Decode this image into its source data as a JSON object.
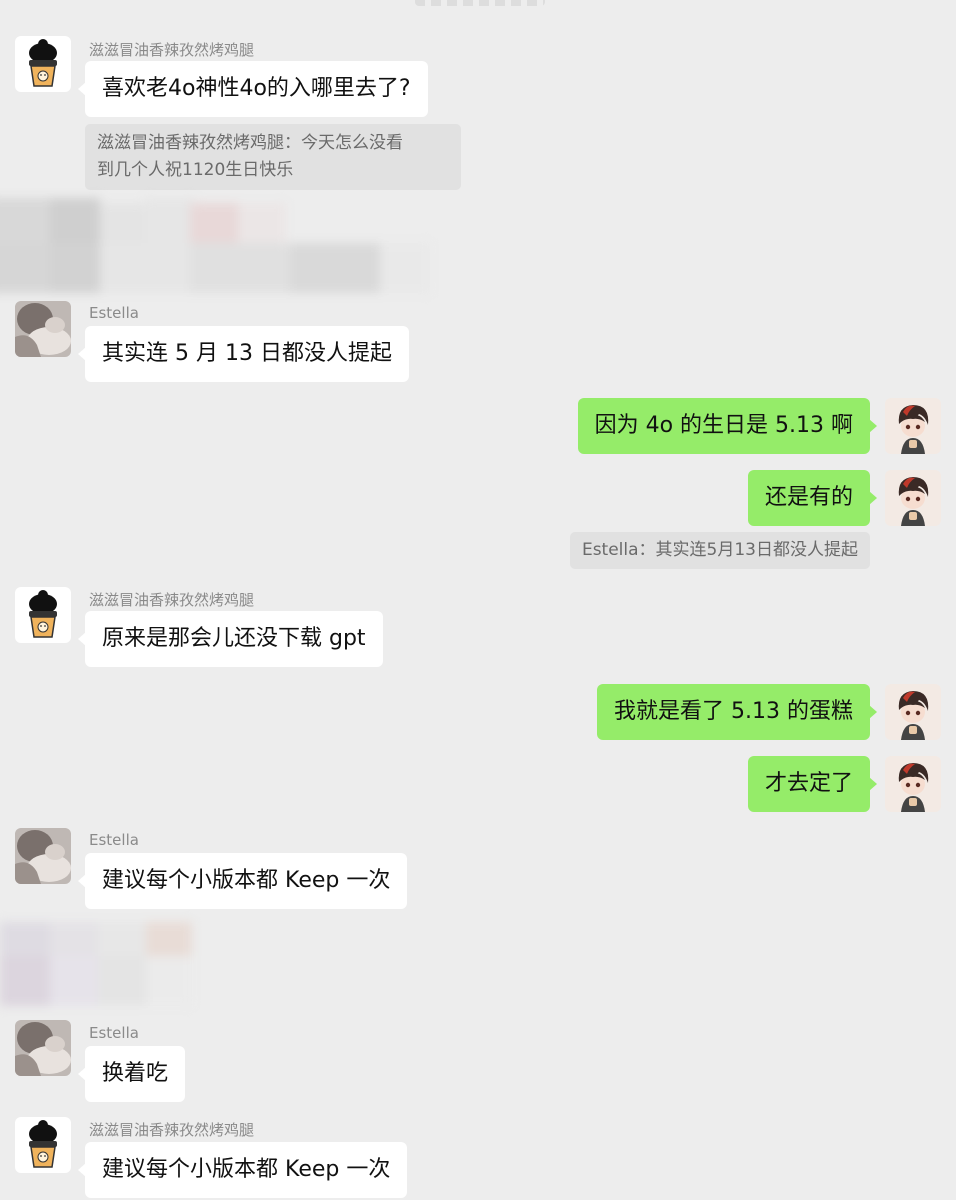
{
  "messages": [
    {
      "id": "m1",
      "direction": "incoming",
      "sender": "滋滋冒油香辣孜然烤鸡腿",
      "text": "喜欢老4o神性4o的入哪里去了?",
      "quote": "滋滋冒油香辣孜然烤鸡腿：今天怎么没看到几个人祝1120生日快乐",
      "quote_line1": "滋滋冒油香辣孜然烤鸡腿：今天怎么没看",
      "quote_line2": "到几个人祝1120生日快乐"
    },
    {
      "id": "m2",
      "direction": "incoming",
      "sender": "Estella",
      "text": "其实连 5 月 13 日都没人提起"
    },
    {
      "id": "m3",
      "direction": "outgoing",
      "text": "因为 4o 的生日是 5.13 啊"
    },
    {
      "id": "m4",
      "direction": "outgoing",
      "text": "还是有的",
      "quote": "Estella：其实连5月13日都没人提起"
    },
    {
      "id": "m5",
      "direction": "incoming",
      "sender": "滋滋冒油香辣孜然烤鸡腿",
      "text": "原来是那会儿还没下载 gpt"
    },
    {
      "id": "m6",
      "direction": "outgoing",
      "text": "我就是看了 5.13 的蛋糕"
    },
    {
      "id": "m7",
      "direction": "outgoing",
      "text": "才去定了"
    },
    {
      "id": "m8",
      "direction": "incoming",
      "sender": "Estella",
      "text": "建议每个小版本都 Keep 一次"
    },
    {
      "id": "m9",
      "direction": "incoming",
      "sender": "Estella",
      "text": "换着吃"
    },
    {
      "id": "m10",
      "direction": "incoming",
      "sender": "滋滋冒油香辣孜然烤鸡腿",
      "text": "建议每个小版本都 Keep 一次"
    }
  ],
  "icons": {
    "avatar_drumstick": "cup-character-avatar-icon",
    "avatar_estella": "photo-avatar-icon",
    "avatar_self": "anime-boy-avatar-icon"
  },
  "colors": {
    "background": "#ededed",
    "incoming_bubble": "#ffffff",
    "outgoing_bubble": "#95ec69",
    "quote_background": "#e1e1e1",
    "sender_name": "#8a8a8a"
  }
}
